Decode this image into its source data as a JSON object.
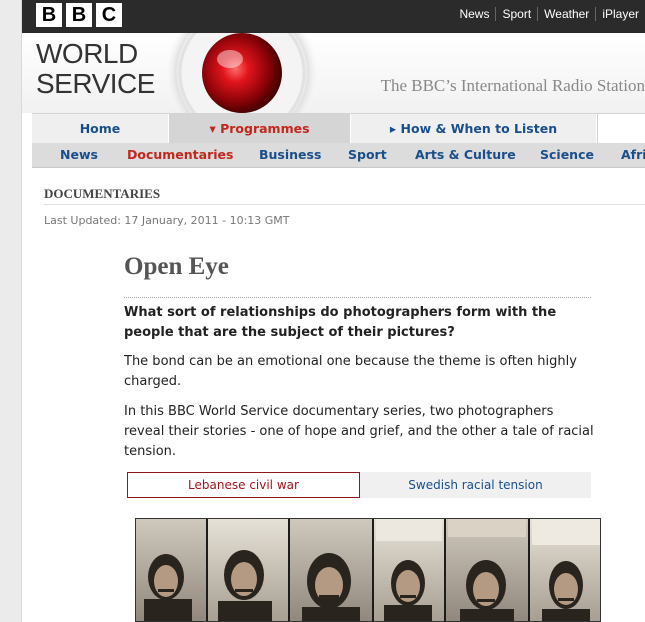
{
  "topbar": {
    "logo_letters": [
      "B",
      "B",
      "C"
    ],
    "links": [
      "News",
      "Sport",
      "Weather",
      "iPlayer"
    ]
  },
  "masthead": {
    "title_line1": "WORLD",
    "title_line2": "SERVICE",
    "tagline": "The BBC’s International Radio Station"
  },
  "nav_primary": {
    "items": [
      {
        "label": "Home"
      },
      {
        "label": "▾ Programmes"
      },
      {
        "label": "▸ How & When to Listen"
      }
    ]
  },
  "nav_secondary": {
    "items": [
      {
        "label": "News"
      },
      {
        "label": "Documentaries"
      },
      {
        "label": "Business"
      },
      {
        "label": "Sport"
      },
      {
        "label": "Arts & Culture"
      },
      {
        "label": "Science"
      },
      {
        "label": "Afri"
      }
    ]
  },
  "section": {
    "label": "DOCUMENTARIES",
    "updated": "Last Updated:  17 January, 2011 - 10:13 GMT"
  },
  "article": {
    "headline": "Open Eye",
    "intro": "What sort of relationships do photographers form with the people that are the subject of their pictures?",
    "para1": "The bond can be an emotional one because the theme is often highly charged.",
    "para2": "In this BBC World Service documentary series, two photographers reveal their stories - one of hope and grief, and the other a tale of racial tension."
  },
  "tabs": [
    {
      "label": "Lebanese civil war"
    },
    {
      "label": "Swedish racial tension"
    }
  ],
  "colors": {
    "link_blue": "#1a4e8a",
    "accent_red": "#c0281d",
    "topbar": "#2b2b2b"
  }
}
